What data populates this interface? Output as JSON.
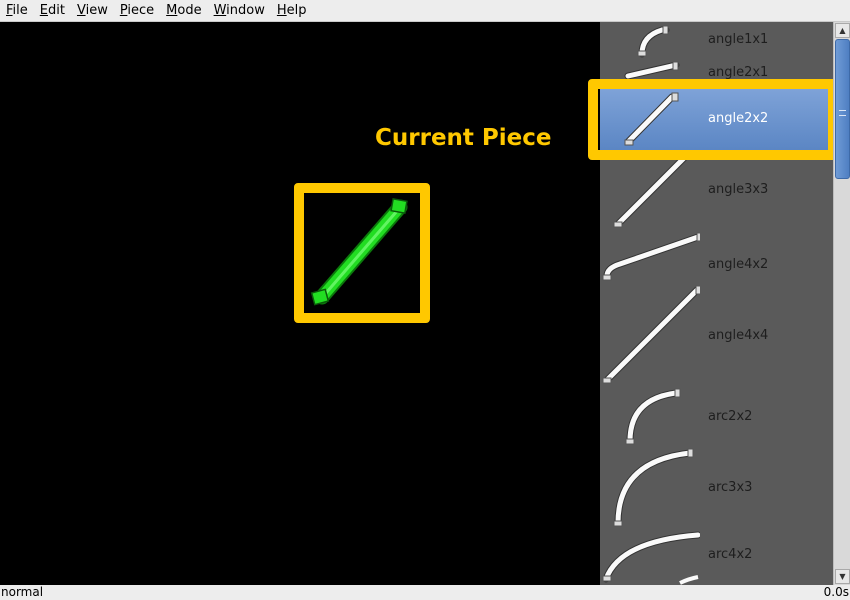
{
  "menu": [
    {
      "mnemonic": "F",
      "rest": "ile"
    },
    {
      "mnemonic": "E",
      "rest": "dit"
    },
    {
      "mnemonic": "V",
      "rest": "iew"
    },
    {
      "mnemonic": "P",
      "rest": "iece"
    },
    {
      "mnemonic": "M",
      "rest": "ode"
    },
    {
      "mnemonic": "W",
      "rest": "indow"
    },
    {
      "mnemonic": "H",
      "rest": "elp"
    }
  ],
  "annotation": "Current Piece",
  "pieces": [
    {
      "name": "angle1x1",
      "selected": false
    },
    {
      "name": "angle2x1",
      "selected": false
    },
    {
      "name": "angle2x2",
      "selected": true
    },
    {
      "name": "angle3x3",
      "selected": false
    },
    {
      "name": "angle4x2",
      "selected": false
    },
    {
      "name": "angle4x4",
      "selected": false
    },
    {
      "name": "arc2x2",
      "selected": false
    },
    {
      "name": "arc3x3",
      "selected": false
    },
    {
      "name": "arc4x2",
      "selected": false
    }
  ],
  "colors": {
    "highlight": "#ffc800",
    "current_piece": "#22dd22",
    "selection": "#6b93cf"
  },
  "status": {
    "mode": "normal",
    "time": "0.0s"
  }
}
